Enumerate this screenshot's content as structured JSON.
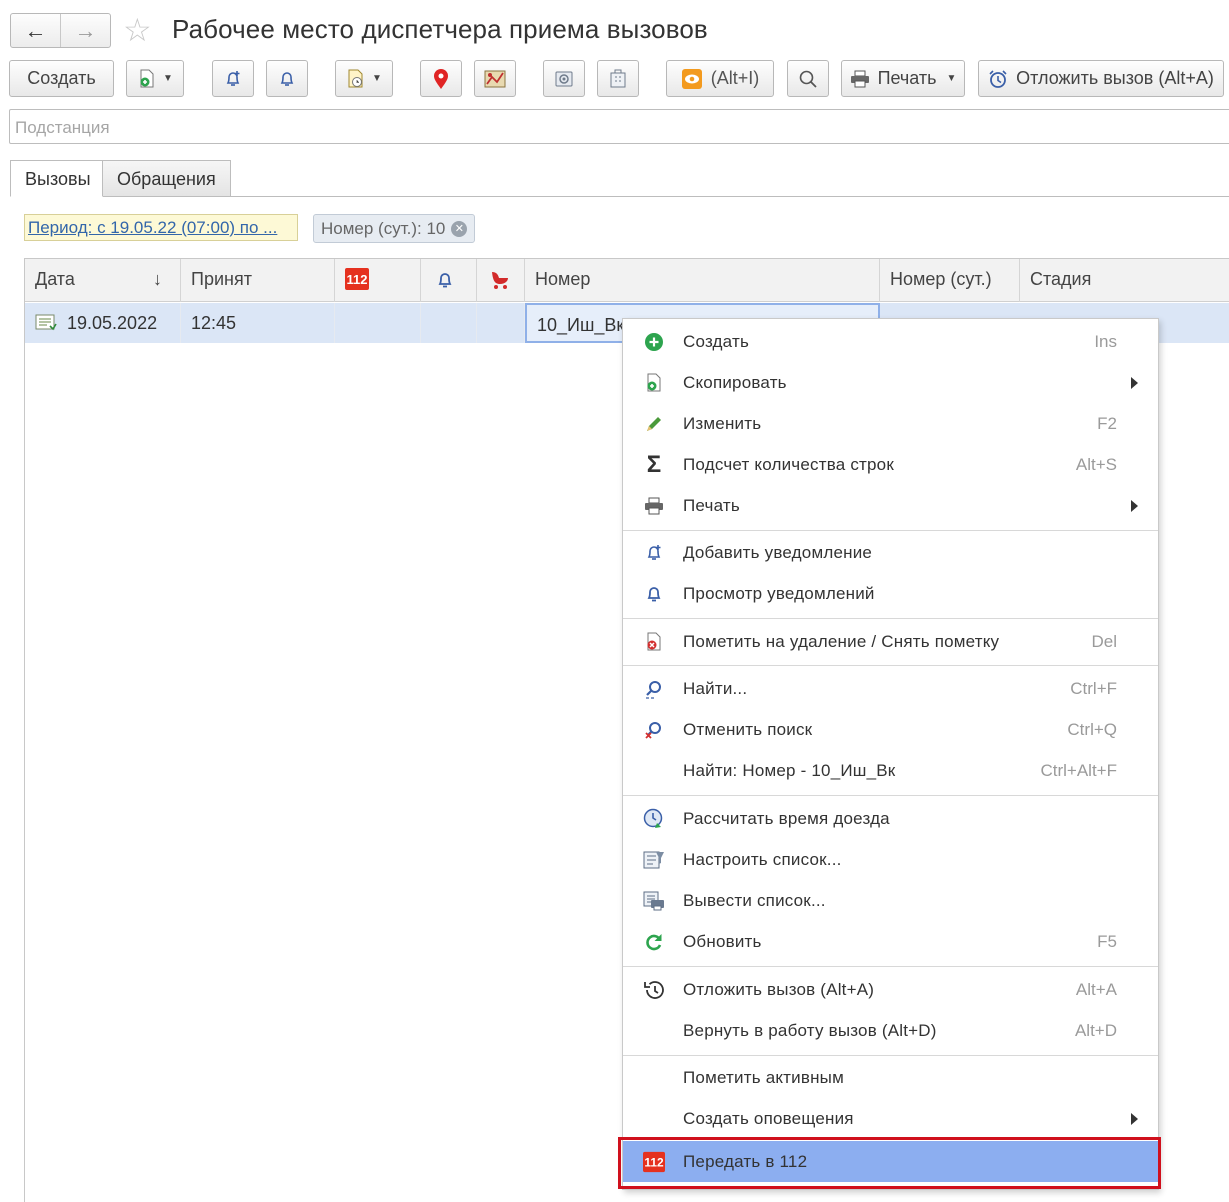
{
  "window": {
    "title": "Рабочее место диспетчера приема вызовов",
    "back_label": "←",
    "forward_label": "→"
  },
  "toolbar": {
    "create_label": "Создать",
    "alt_i_label": "(Alt+I)",
    "print_label": "Печать",
    "postpone_label": "Отложить вызов (Alt+A)"
  },
  "filter": {
    "substation_placeholder": "Подстанция"
  },
  "tabs": [
    {
      "label": "Вызовы"
    },
    {
      "label": "Обращения"
    }
  ],
  "chips": {
    "period": "Период: с 19.05.22 (07:00) по ...",
    "number": "Номер (сут.): 10"
  },
  "table": {
    "columns": [
      "Дата",
      "Принят",
      "Номер",
      "Номер (сут.)",
      "Стадия"
    ],
    "sort_glyph": "↓",
    "rows": [
      {
        "date": "19.05.2022",
        "accepted": "12:45",
        "number": "10_Иш_Вк"
      }
    ]
  },
  "context_menu": {
    "items": [
      {
        "label": "Создать",
        "shortcut": "Ins"
      },
      {
        "label": "Скопировать",
        "shortcut": ""
      },
      {
        "label": "Изменить",
        "shortcut": "F2"
      },
      {
        "label": "Подсчет количества строк",
        "shortcut": "Alt+S"
      },
      {
        "label": "Печать",
        "shortcut": ""
      },
      {
        "label": "Добавить уведомление",
        "shortcut": ""
      },
      {
        "label": "Просмотр уведомлений",
        "shortcut": ""
      },
      {
        "label": "Пометить на удаление / Снять пометку",
        "shortcut": "Del"
      },
      {
        "label": "Найти...",
        "shortcut": "Ctrl+F"
      },
      {
        "label": "Отменить поиск",
        "shortcut": "Ctrl+Q"
      },
      {
        "label": "Найти: Номер - 10_Иш_Вк",
        "shortcut": "Ctrl+Alt+F"
      },
      {
        "label": "Рассчитать время доезда",
        "shortcut": ""
      },
      {
        "label": "Настроить список...",
        "shortcut": ""
      },
      {
        "label": "Вывести список...",
        "shortcut": ""
      },
      {
        "label": "Обновить",
        "shortcut": "F5"
      },
      {
        "label": "Отложить вызов (Alt+A)",
        "shortcut": "Alt+A"
      },
      {
        "label": "Вернуть в работу вызов (Alt+D)",
        "shortcut": "Alt+D"
      },
      {
        "label": "Пометить активным",
        "shortcut": ""
      },
      {
        "label": "Создать оповещения",
        "shortcut": ""
      },
      {
        "label": "Передать в 112",
        "shortcut": ""
      }
    ]
  },
  "icons": {
    "badge_112_text": "112"
  },
  "colors": {
    "accent_red": "#d0101d",
    "selection_blue": "#8caef0",
    "row_highlight": "#dbe6f6",
    "period_chip_bg": "#fdf9d6",
    "link_blue": "#3366aa"
  }
}
